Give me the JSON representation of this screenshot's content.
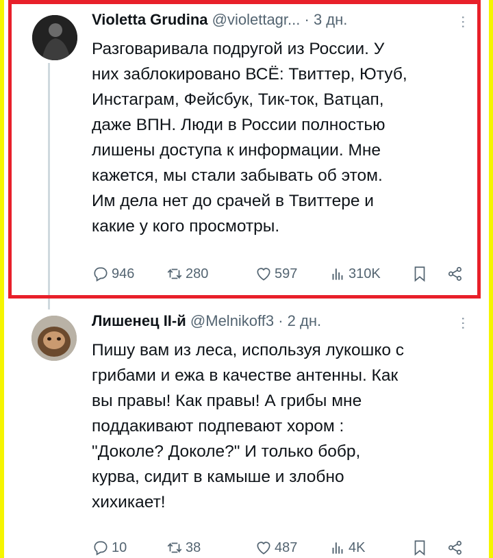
{
  "tweets": [
    {
      "name": "Violetta Grudina",
      "handle": "@violettagr...",
      "time": "· 3 дн.",
      "text_lines": [
        "Разговаривала подругой из России. У",
        "них заблокировано ВСЁ: Твиттер, Ютуб,",
        "Инстаграм, Фейсбук, Тик-ток, Ватцап,",
        "даже ВПН. Люди в России полностью",
        "лишены доступа к информации. Мне",
        "кажется, мы стали забывать об этом.",
        "Им дела нет до срачей в Твиттере и",
        "какие у кого просмотры."
      ],
      "replies": "946",
      "retweets": "280",
      "likes": "597",
      "views": "310K"
    },
    {
      "name": "Лишенец II-й",
      "handle": "@Melnikoff3",
      "time": "· 2 дн.",
      "text_lines": [
        "Пишу вам из леса, используя лукошко с",
        "грибами и ежа в качестве антенны. Как",
        "вы правы! Как правы! А грибы мне",
        "поддакивают подпевают хором :",
        "\"Доколе? Доколе?\" И только бобр,",
        "курва, сидит в камыше и злобно",
        "хихикает!"
      ],
      "replies": "10",
      "retweets": "38",
      "likes": "487",
      "views": "4K"
    }
  ],
  "colors": {
    "frame": "#f5f500",
    "highlight": "#e8202a",
    "text": "#0f1419",
    "muted": "#536471"
  }
}
